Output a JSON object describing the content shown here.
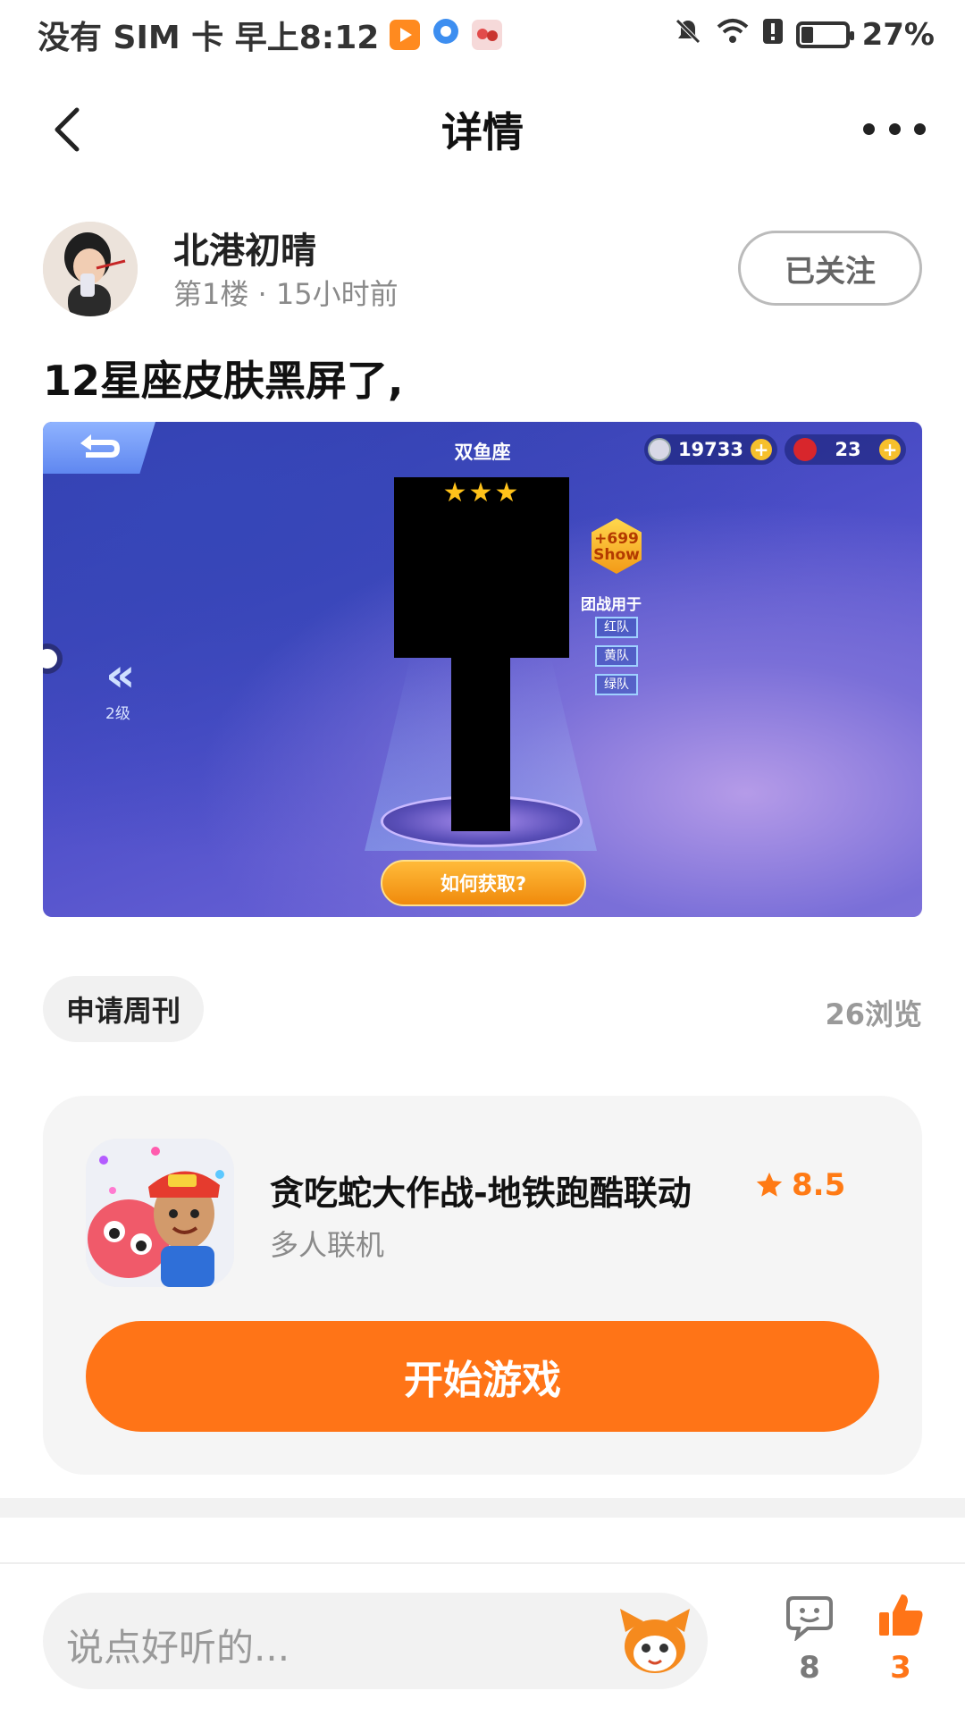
{
  "status_bar": {
    "left_text": "没有 SIM 卡 早上8:12",
    "battery": "27%",
    "battery_level": 0.27
  },
  "header": {
    "title": "详情",
    "back_icon": "chevron-left-icon",
    "more_icon": "more-horizontal-icon"
  },
  "post": {
    "author_name": "北港初晴",
    "meta": "第1楼 · 15小时前",
    "follow_label": "已关注",
    "title": "12星座皮肤黑屏了,"
  },
  "screenshot": {
    "zodiac": "双鱼座",
    "coins": "19733",
    "apples": "23",
    "stars": "★★★",
    "show_badge_top": "+699",
    "show_badge_bottom": "Show",
    "team_title": "团战用于",
    "teams": [
      "红队",
      "黄队",
      "绿队"
    ],
    "level": "2级",
    "how_button": "如何获取?"
  },
  "tag_label": "申请周刊",
  "views": "26浏览",
  "game": {
    "name": "贪吃蛇大作战-地铁跑酷联动",
    "rating": "8.5",
    "genre": "多人联机",
    "play_label": "开始游戏"
  },
  "bottom_bar": {
    "placeholder": "说点好听的...",
    "comment_count": "8",
    "like_count": "3"
  },
  "colors": {
    "accent": "#ff7417",
    "muted_text": "#8a8a8a"
  }
}
